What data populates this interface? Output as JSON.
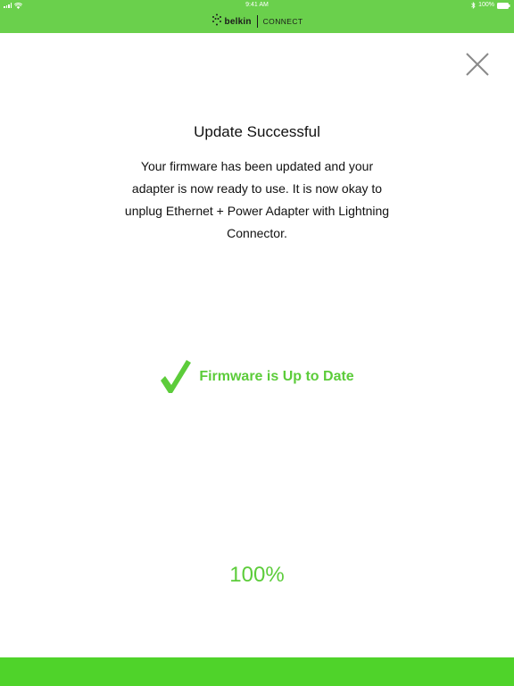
{
  "status_bar": {
    "time": "9:41 AM",
    "battery": "100%"
  },
  "header": {
    "brand": "belkin",
    "product": "CONNECT",
    "color": "#6ad04c"
  },
  "dialog": {
    "title": "Update Successful",
    "message": "Your firmware has been updated and your adapter is now ready to use. It is now okay to unplug Ethernet + Power Adapter with Lightning Connector.",
    "status_text": "Firmware is Up to Date",
    "progress": "100%",
    "accent_color": "#5ccc3a"
  },
  "icons": [
    "signal-icon",
    "wifi-icon",
    "bluetooth-icon",
    "battery-icon",
    "belkin-logo-icon",
    "close-icon",
    "checkmark-icon"
  ]
}
